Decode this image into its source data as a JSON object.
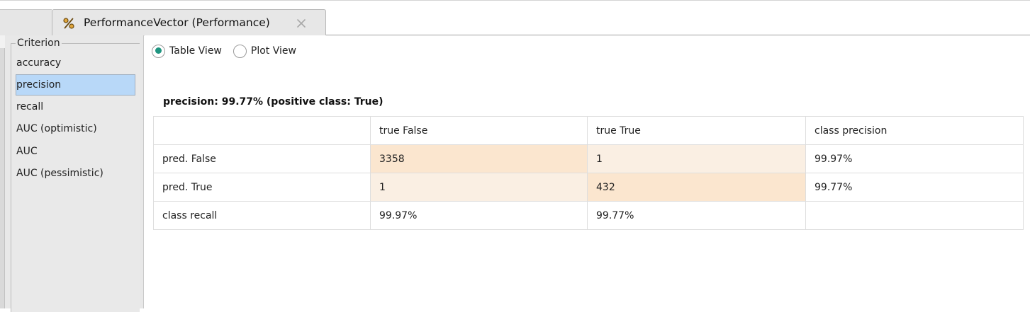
{
  "tab": {
    "title": "PerformanceVector (Performance)",
    "icon": "percent-icon",
    "close_icon": "close-icon"
  },
  "sidebar": {
    "legend": "Criterion",
    "items": [
      {
        "label": "accuracy",
        "selected": false
      },
      {
        "label": "precision",
        "selected": true
      },
      {
        "label": "recall",
        "selected": false
      },
      {
        "label": "AUC (optimistic)",
        "selected": false
      },
      {
        "label": "AUC",
        "selected": false
      },
      {
        "label": "AUC (pessimistic)",
        "selected": false
      }
    ]
  },
  "view_toggle": {
    "table_view": "Table View",
    "plot_view": "Plot View",
    "selected": "table_view"
  },
  "result": {
    "caption": "precision: 99.77% (positive class: True)",
    "headers": [
      "",
      "true False",
      "true True",
      "class precision"
    ],
    "rows": [
      [
        "pred. False",
        "3358",
        "1",
        "99.97%"
      ],
      [
        "pred. True",
        "1",
        "432",
        "99.77%"
      ],
      [
        "class recall",
        "99.97%",
        "99.77%",
        ""
      ]
    ]
  },
  "colors": {
    "selection": "#b8d8f8",
    "radio_accent": "#1f9580",
    "cell_strong": "#fbe6cf",
    "cell_light": "#faefe3"
  }
}
